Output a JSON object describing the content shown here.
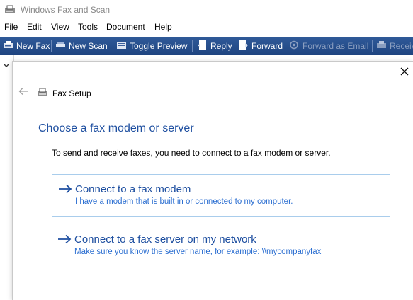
{
  "window": {
    "title": "Windows Fax and Scan"
  },
  "menu": [
    "File",
    "Edit",
    "View",
    "Tools",
    "Document",
    "Help"
  ],
  "toolbar": {
    "new_fax": "New Fax",
    "new_scan": "New Scan",
    "toggle_preview": "Toggle Preview",
    "reply": "Reply",
    "forward": "Forward",
    "forward_email": "Forward as Email",
    "receive": "Receiv"
  },
  "dialog": {
    "title": "Fax Setup",
    "heading": "Choose a fax modem or server",
    "instruction": "To send and receive faxes, you need to connect to a fax modem or server.",
    "options": [
      {
        "title": "Connect to a fax modem",
        "description": "I have a modem that is built in or connected to my computer."
      },
      {
        "title": "Connect to a fax server on my network",
        "description": "Make sure you know the server name, for example: \\\\mycompanyfax"
      }
    ]
  },
  "colors": {
    "accent": "#1e4fa0",
    "link_description": "#2c6fd1",
    "toolbar": "#2a5293"
  },
  "icons": [
    "fax-app-icon",
    "new-fax-icon",
    "new-scan-icon",
    "toggle-preview-icon",
    "reply-icon",
    "forward-icon",
    "forward-email-icon",
    "receive-icon",
    "close-icon",
    "back-arrow-icon",
    "fax-setup-icon",
    "arrow-right-icon",
    "chevron-down-icon"
  ]
}
